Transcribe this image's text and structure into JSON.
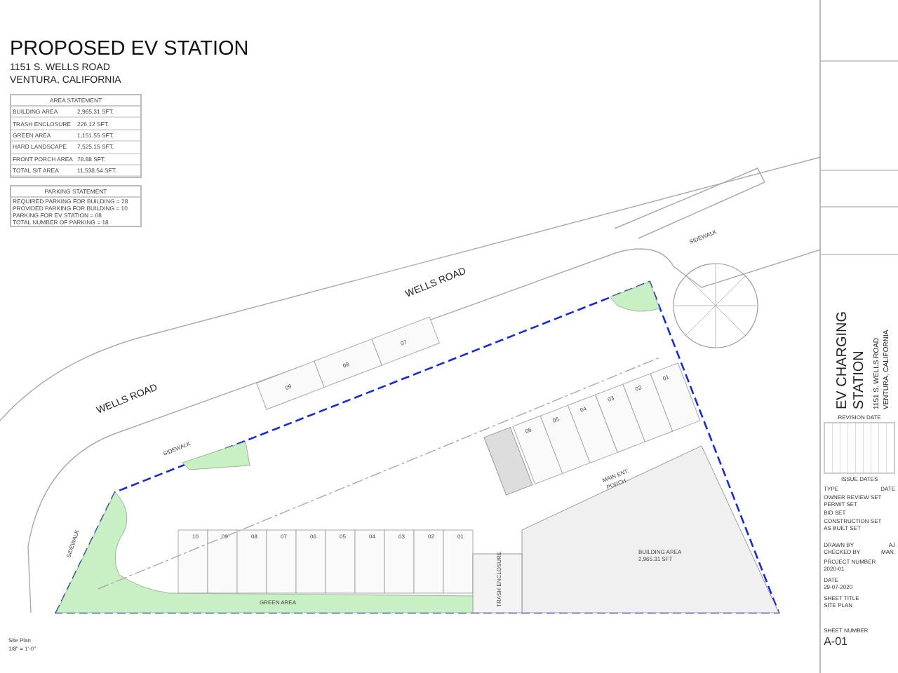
{
  "title": "PROPOSED EV STATION",
  "address": [
    "1151 S.  WELLS ROAD",
    "VENTURA, CALIFORNIA"
  ],
  "area_statement": {
    "heading": "AREA STATEMENT",
    "rows": [
      {
        "label": "BUILDING AREA",
        "value": "2,965.31 SFT."
      },
      {
        "label": "TRASH ENCLOSURE",
        "value": "226.12 SFT."
      },
      {
        "label": "GREEN AREA",
        "value": "1,151.55 SFT."
      },
      {
        "label": "HARD LANDSCAPE",
        "value": "7,525.15 SFT."
      },
      {
        "label": "FRONT PORCH AREA",
        "value": "78.88 SFT."
      },
      {
        "label": "TOTAL SIT AREA",
        "value": "11,538.54 SFT."
      }
    ]
  },
  "parking_statement": {
    "heading": "PARKING STATEMENT",
    "lines": [
      "REQUIRED PARKING FOR BUILDING = 28",
      "PROVIDED PARKING FOR BUILDING = 10",
      "PARKING FOR EV STATION = 08",
      "TOTAL NUMBER OF PARKING = 18"
    ]
  },
  "site_plan": {
    "road_labels": [
      "WELLS ROAD",
      "WELLS ROAD"
    ],
    "sidewalk_labels": [
      "SIDEWALK",
      "SIDEWALK",
      "SIDEWALK"
    ],
    "green_area_label": "GREEN AREA",
    "trash_enclosure_label": "TRASH ENCLOSURE",
    "building_area_label": [
      "BUILDING AREA",
      "2,965.31 SFT"
    ],
    "porch_label": [
      "MAIN ENT.",
      "PORCH"
    ],
    "bottom_stalls": [
      "10",
      "09",
      "08",
      "07",
      "06",
      "05",
      "04",
      "03",
      "02",
      "01"
    ],
    "right_stalls": [
      "06",
      "05",
      "04",
      "03",
      "02",
      "01"
    ],
    "top_stalls": [
      "09",
      "08",
      "07"
    ],
    "caption": [
      "Site Plan",
      "1/8\" = 1'-0\""
    ]
  },
  "title_block": {
    "project_title": [
      "EV CHARGING",
      "STATION"
    ],
    "project_address": [
      "1151 S.  WELLS ROAD",
      "VENTURA, CALIFORNIA"
    ],
    "revision_heading": "REVISION DATE",
    "issue_heading": "ISSUE DATES",
    "columns": [
      "TYPE",
      "DATE"
    ],
    "issues": [
      "OWNER REVIEW SET",
      "PERMIT SET",
      "BID SET",
      "CONSTRUCTION SET",
      "AS BUILT SET"
    ],
    "drawn_by": {
      "label": "DRAWN BY",
      "value": "AJ"
    },
    "checked_by": {
      "label": "CHECKED BY",
      "value": "MAN."
    },
    "fields": [
      {
        "label": "PROJECT NUMBER",
        "value": "2020-01"
      },
      {
        "label": "DATE",
        "value": "29-07-2020"
      },
      {
        "label": "SHEET TITLE",
        "value": "SITE PLAN"
      }
    ],
    "sheet_label": "SHEET NUMBER",
    "sheet_number": "A-01"
  }
}
